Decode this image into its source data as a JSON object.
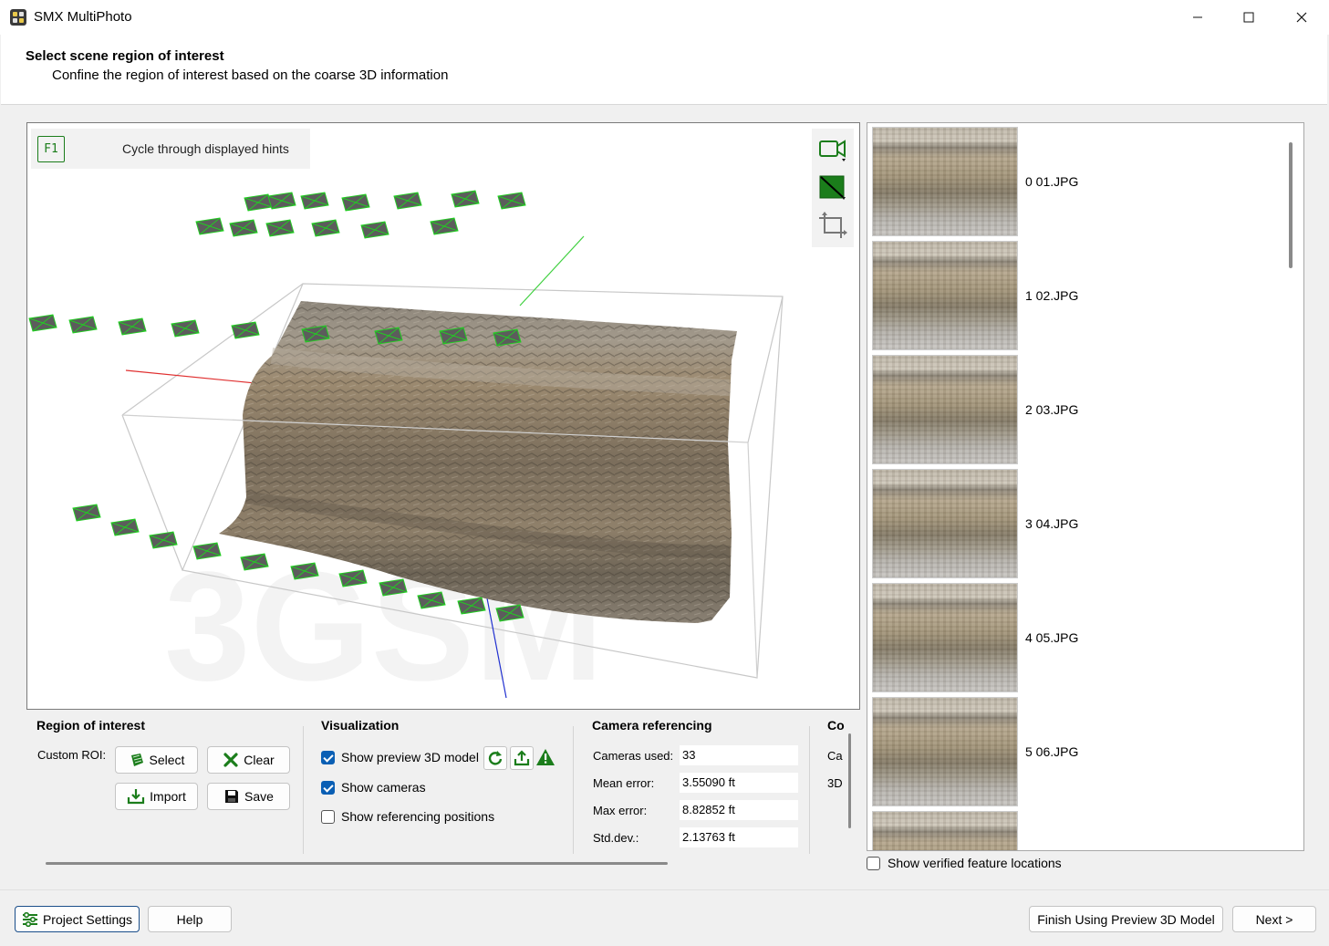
{
  "window": {
    "title": "SMX MultiPhoto",
    "controls": [
      "minimize-icon",
      "maximize-icon",
      "close-icon"
    ]
  },
  "header": {
    "title": "Select scene region of interest",
    "subtitle": "Confine the region of interest based on the coarse 3D information"
  },
  "viewport": {
    "hint_key": "F1",
    "hint_text": "Cycle through displayed hints",
    "watermark": "3GSM",
    "tools": [
      "camera-view-icon",
      "color-mode-icon",
      "crop-box-icon"
    ]
  },
  "image_list": {
    "items": [
      {
        "label": "0 01.JPG"
      },
      {
        "label": "1 02.JPG"
      },
      {
        "label": "2 03.JPG"
      },
      {
        "label": "3 04.JPG"
      },
      {
        "label": "4 05.JPG"
      },
      {
        "label": "5 06.JPG"
      }
    ],
    "verified_label": "Show verified feature locations",
    "verified_checked": false
  },
  "roi": {
    "title": "Region of interest",
    "custom_label": "Custom ROI:",
    "select": "Select",
    "clear": "Clear",
    "import": "Import",
    "save": "Save"
  },
  "visualization": {
    "title": "Visualization",
    "preview_label": "Show preview 3D model",
    "preview_checked": true,
    "cameras_label": "Show cameras",
    "cameras_checked": true,
    "ref_label": "Show referencing positions",
    "ref_checked": false
  },
  "camera_ref": {
    "title": "Camera referencing",
    "used_label": "Cameras used:",
    "used_value": "33",
    "mean_label": "Mean error:",
    "mean_value": "3.55090 ft",
    "max_label": "Max error:",
    "max_value": "8.82852 ft",
    "std_label": "Std.dev.:",
    "std_value": "2.13763 ft"
  },
  "cut_panel": {
    "title": "Co",
    "line1": "Ca",
    "line2": "3D"
  },
  "footer": {
    "project_settings": "Project Settings",
    "help": "Help",
    "finish": "Finish Using Preview 3D Model",
    "next": "Next >"
  },
  "colors": {
    "accent_green": "#1b7d1b",
    "checkbox_blue": "#0a5fb4"
  }
}
